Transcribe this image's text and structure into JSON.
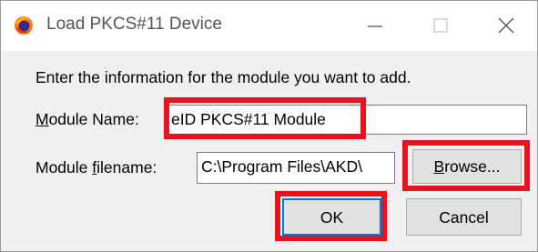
{
  "window": {
    "title": "Load PKCS#11 Device",
    "app_icon": "firefox-icon",
    "controls": [
      "minimize-icon",
      "maximize-icon",
      "close-icon"
    ]
  },
  "dialog": {
    "prompt": "Enter the information for the module you want to add.",
    "module_name": {
      "label_prefix": "M",
      "label_rest": "odule Name:",
      "value": "eID PKCS#11 Module"
    },
    "module_filename": {
      "label_prefix": "Module ",
      "label_accel": "f",
      "label_rest": "ilename:",
      "value": "C:\\Program Files\\AKD\\"
    },
    "buttons": {
      "browse_accel": "B",
      "browse_rest": "rowse...",
      "ok": "OK",
      "cancel": "Cancel"
    }
  },
  "colors": {
    "highlight": "#e8131d",
    "focus_border": "#0078d7"
  }
}
